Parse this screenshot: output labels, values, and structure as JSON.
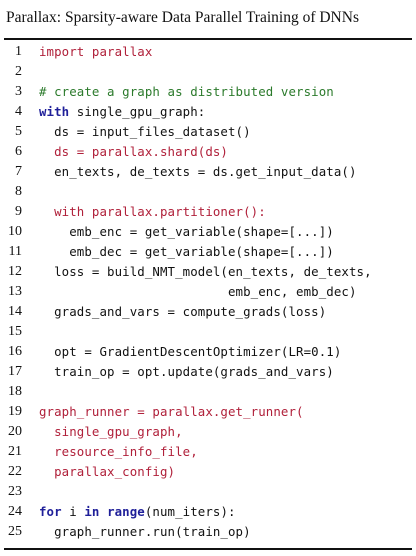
{
  "caption": "Parallax: Sparsity-aware Data Parallel Training of DNNs",
  "listing": {
    "lines": [
      {
        "n": "1",
        "parts": [
          {
            "t": "import parallax",
            "k": "hl"
          }
        ]
      },
      {
        "n": "2",
        "parts": []
      },
      {
        "n": "3",
        "parts": [
          {
            "t": "# create a graph as distributed version",
            "k": "cm"
          }
        ]
      },
      {
        "n": "4",
        "parts": [
          {
            "t": "with",
            "k": "kw"
          },
          {
            "t": " single_gpu_graph:",
            "k": "pl"
          }
        ]
      },
      {
        "n": "5",
        "parts": [
          {
            "t": "  ds = input_files_dataset()",
            "k": "pl"
          }
        ]
      },
      {
        "n": "6",
        "parts": [
          {
            "t": "  ds = parallax.shard(ds)",
            "k": "hl"
          }
        ]
      },
      {
        "n": "7",
        "parts": [
          {
            "t": "  en_texts, de_texts = ds.get_input_data()",
            "k": "pl"
          }
        ]
      },
      {
        "n": "8",
        "parts": []
      },
      {
        "n": "9",
        "parts": [
          {
            "t": "  with parallax.partitioner():",
            "k": "hl"
          }
        ]
      },
      {
        "n": "10",
        "parts": [
          {
            "t": "    emb_enc = get_variable(shape=[...])",
            "k": "pl"
          }
        ]
      },
      {
        "n": "11",
        "parts": [
          {
            "t": "    emb_dec = get_variable(shape=[...])",
            "k": "pl"
          }
        ]
      },
      {
        "n": "12",
        "parts": [
          {
            "t": "  loss = build_NMT_model(en_texts, de_texts,",
            "k": "pl"
          }
        ]
      },
      {
        "n": "13",
        "parts": [
          {
            "t": "                         emb_enc, emb_dec)",
            "k": "pl"
          }
        ]
      },
      {
        "n": "14",
        "parts": [
          {
            "t": "  grads_and_vars = compute_grads(loss)",
            "k": "pl"
          }
        ]
      },
      {
        "n": "15",
        "parts": []
      },
      {
        "n": "16",
        "parts": [
          {
            "t": "  opt = GradientDescentOptimizer(LR=0.1)",
            "k": "pl"
          }
        ]
      },
      {
        "n": "17",
        "parts": [
          {
            "t": "  train_op = opt.update(grads_and_vars)",
            "k": "pl"
          }
        ]
      },
      {
        "n": "18",
        "parts": []
      },
      {
        "n": "19",
        "parts": [
          {
            "t": "graph_runner = parallax.get_runner(",
            "k": "hl"
          }
        ]
      },
      {
        "n": "20",
        "parts": [
          {
            "t": "  single_gpu_graph,",
            "k": "hl"
          }
        ]
      },
      {
        "n": "21",
        "parts": [
          {
            "t": "  resource_info_file,",
            "k": "hl"
          }
        ]
      },
      {
        "n": "22",
        "parts": [
          {
            "t": "  parallax_config)",
            "k": "hl"
          }
        ]
      },
      {
        "n": "23",
        "parts": []
      },
      {
        "n": "24",
        "parts": [
          {
            "t": "for",
            "k": "kw"
          },
          {
            "t": " i ",
            "k": "pl"
          },
          {
            "t": "in",
            "k": "kw"
          },
          {
            "t": " ",
            "k": "pl"
          },
          {
            "t": "range",
            "k": "kw"
          },
          {
            "t": "(num_iters):",
            "k": "pl"
          }
        ]
      },
      {
        "n": "25",
        "parts": [
          {
            "t": "  graph_runner.run(train_op)",
            "k": "pl"
          }
        ]
      }
    ]
  }
}
